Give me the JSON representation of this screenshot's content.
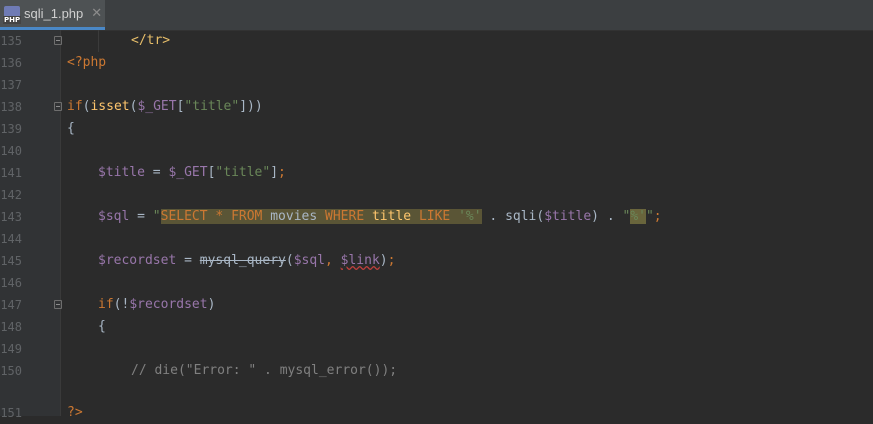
{
  "tab": {
    "filename": "sqli_1.php",
    "close_glyph": "✕",
    "icon": "php-file-icon",
    "badge": "PHP"
  },
  "line_numbers": [
    "135",
    "136",
    "137",
    "138",
    "139",
    "140",
    "141",
    "142",
    "143",
    "144",
    "145",
    "146",
    "147",
    "148",
    "149",
    "150",
    "151"
  ],
  "code": {
    "l135": "</tr>",
    "l136": "<?php",
    "l138": {
      "if": "if",
      "p1": "(",
      "isset": "isset",
      "p2": "(",
      "get": "$_GET",
      "b1": "[",
      "str": "\"title\"",
      "b2": "]))"
    },
    "l139": "{",
    "l141": {
      "var": "$title",
      "eq": " = ",
      "get": "$_GET",
      "b1": "[",
      "str": "\"title\"",
      "b2": "]",
      "semi": ";"
    },
    "l143": {
      "var": "$sql",
      "eq": " = ",
      "q1": "\"",
      "sql1": "SELECT",
      "star": " * ",
      "sql2": "FROM",
      "movies": " movies ",
      "sql3": "WHERE",
      "sp1": " ",
      "title": "title",
      "sp2": " ",
      "sql4": "LIKE",
      "sp3": " ",
      "pct1": "'%'",
      "concat1": " . ",
      "fn": "sqli",
      "p1": "(",
      "arg": "$title",
      "p2": ")",
      "concat2": " . ",
      "q2": "\"",
      "pct2": "%'",
      "q3": "\"",
      "semi": ";"
    },
    "l145": {
      "var": "$recordset",
      "eq": " = ",
      "fn": "mysql_query",
      "p1": "(",
      "a1": "$sql",
      "comma": ", ",
      "a2": "$link",
      "p2": ")",
      "semi": ";"
    },
    "l147": {
      "if": "if",
      "p1": "(!",
      "var": "$recordset",
      "p2": ")"
    },
    "l148": "{",
    "l150": "// die(\"Error: \" . mysql_error());",
    "l151": "?>"
  }
}
